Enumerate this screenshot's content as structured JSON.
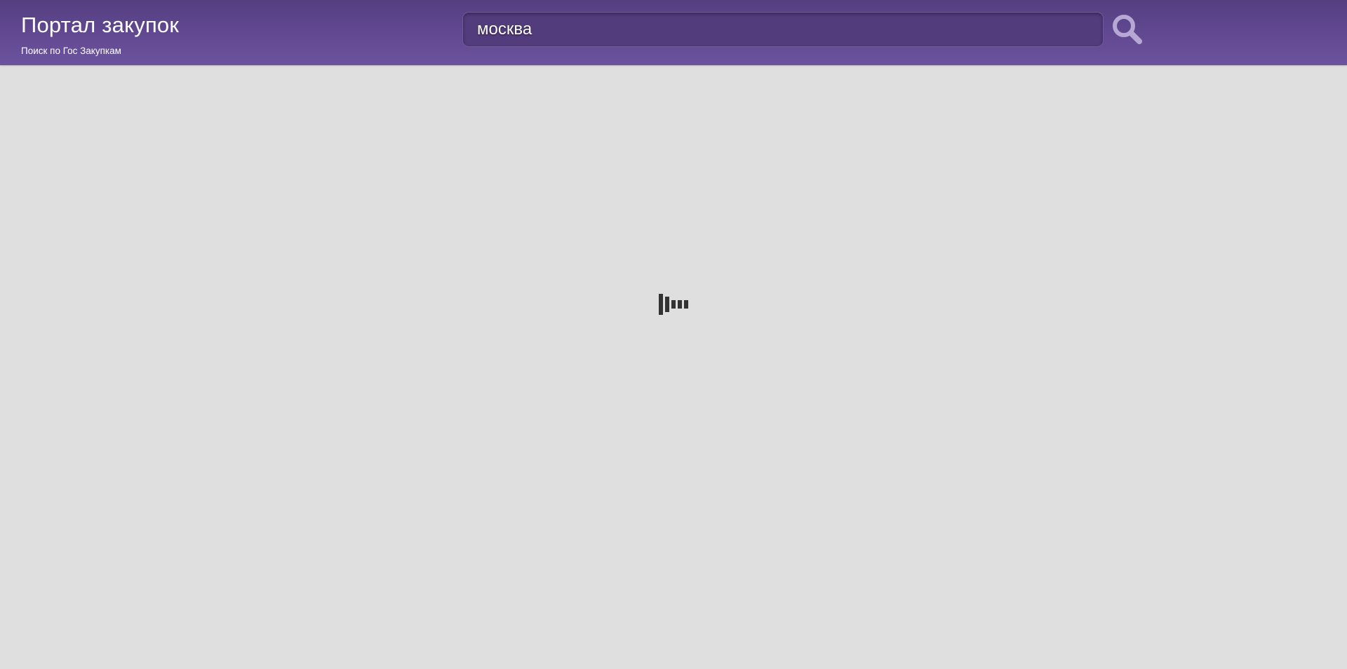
{
  "header": {
    "title": "Портал закупок",
    "subtitle": "Поиск по Гос Закупкам"
  },
  "search": {
    "value": "москва",
    "button_icon": "search-icon"
  },
  "loading": {
    "icon": "loading-indicator"
  },
  "colors": {
    "header_bg": "#614891",
    "page_bg": "#dfdfdf",
    "search_field_bg": "#533c7c",
    "search_icon": "#b7a8d3",
    "loader": "#333333"
  }
}
